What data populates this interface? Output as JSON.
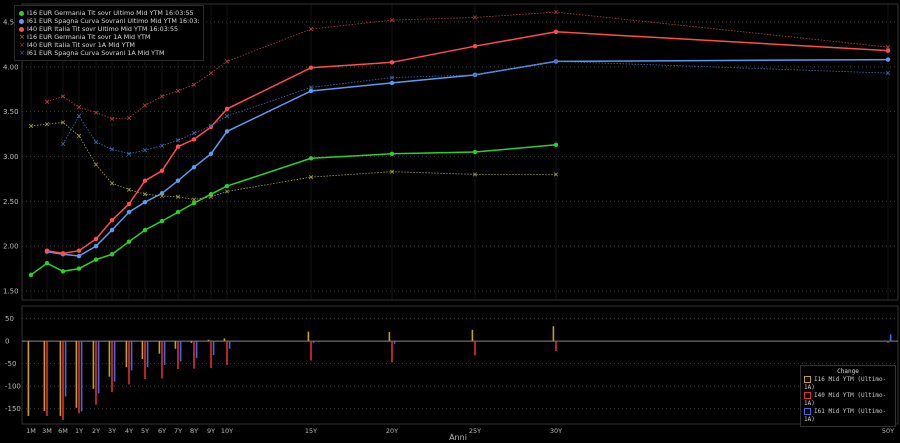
{
  "chart_data": {
    "type": "line",
    "x_categories": [
      "1M",
      "3M",
      "6M",
      "1Y",
      "2Y",
      "3Y",
      "4Y",
      "5Y",
      "6Y",
      "7Y",
      "8Y",
      "9Y",
      "10Y",
      "15Y",
      "20Y",
      "25Y",
      "30Y",
      "50Y"
    ],
    "xlabel": "Anni",
    "ylim": [
      1.4,
      4.7
    ],
    "y_ticks": [
      1.5,
      2.0,
      2.5,
      3.0,
      3.5,
      4.0,
      4.5
    ],
    "y_tick_labels": [
      "1.50",
      "2.00",
      "2.50",
      "3.00",
      "3.50",
      "4.00",
      "4.50"
    ],
    "series": [
      {
        "name": "I16 EUR Germania Tit sovr Ultimo Mid YTM 16:03:55",
        "color": "#2bd12b",
        "style": "solid",
        "values": [
          1.68,
          1.81,
          1.72,
          1.75,
          1.85,
          1.91,
          2.05,
          2.18,
          2.28,
          2.38,
          2.48,
          2.58,
          2.67,
          2.98,
          3.03,
          3.05,
          3.13,
          null
        ]
      },
      {
        "name": "I61 EUR Spagna Curva Sovrani Ultimo Mid YTM 16:03:55",
        "color": "#5c9bf0",
        "style": "solid",
        "values": [
          null,
          1.94,
          1.91,
          1.89,
          2.0,
          2.18,
          2.38,
          2.49,
          2.59,
          2.73,
          2.88,
          3.03,
          3.28,
          3.73,
          3.82,
          3.91,
          4.06,
          4.08
        ]
      },
      {
        "name": "I40 EUR Italia Tit sovr Ultimo Mid YTM 16:03:55",
        "color": "#ff4d4d",
        "style": "solid",
        "values": [
          null,
          1.95,
          1.92,
          1.95,
          2.08,
          2.29,
          2.47,
          2.73,
          2.84,
          3.11,
          3.19,
          3.33,
          3.53,
          3.99,
          4.05,
          4.23,
          4.39,
          4.18
        ]
      },
      {
        "name": "I16 EUR Germania Tit sovr 1A Mid YTM",
        "color": "#a8a032",
        "style": "dotted",
        "values": [
          3.34,
          3.36,
          3.38,
          3.23,
          2.91,
          2.7,
          2.63,
          2.58,
          2.56,
          2.55,
          2.52,
          2.55,
          2.61,
          2.77,
          2.83,
          2.8,
          2.8,
          null
        ]
      },
      {
        "name": "I40 EUR Italia Tit sovr 1A Mid YTM",
        "color": "#b84040",
        "style": "dotted",
        "values": [
          null,
          3.61,
          3.67,
          3.55,
          3.49,
          3.42,
          3.43,
          3.57,
          3.67,
          3.73,
          3.8,
          3.93,
          4.06,
          4.42,
          4.52,
          4.55,
          4.61,
          4.22
        ]
      },
      {
        "name": "I61 EUR Spagna Curva Sovrani 1A Mid YTM",
        "color": "#3e6cb8",
        "style": "dotted",
        "values": [
          null,
          null,
          3.14,
          3.45,
          3.16,
          3.08,
          3.03,
          3.07,
          3.12,
          3.18,
          3.26,
          3.34,
          3.45,
          3.77,
          3.88,
          3.91,
          4.06,
          3.93
        ]
      }
    ],
    "lower_panel": {
      "title": "Change",
      "ylim": [
        -175,
        60
      ],
      "y_ticks": [
        50,
        0,
        -50,
        -100,
        -150
      ],
      "y_tick_labels": [
        "50",
        "0",
        "-50",
        "-100",
        "-150"
      ],
      "series": [
        {
          "name": "I16 Mid YTM (Ultimo-1A)",
          "color": "#c8a020",
          "values": [
            -166,
            -155,
            -166,
            -148,
            -106,
            -79,
            -58,
            -40,
            -28,
            -17,
            -4,
            3,
            6,
            21,
            20,
            25,
            33,
            null
          ]
        },
        {
          "name": "I40 Mid YTM (Ultimo-1A)",
          "color": "#e03030",
          "values": [
            null,
            -166,
            -175,
            -160,
            -141,
            -113,
            -96,
            -84,
            -83,
            -62,
            -61,
            -60,
            -53,
            -43,
            -47,
            -32,
            -22,
            -4
          ]
        },
        {
          "name": "I61 Mid YTM (Ultimo-1A)",
          "color": "#3e6ce0",
          "values": [
            null,
            null,
            -123,
            -156,
            -116,
            -90,
            -65,
            -58,
            -53,
            -45,
            -38,
            -31,
            -17,
            -4,
            -6,
            0,
            0,
            15
          ]
        }
      ]
    }
  },
  "legend_top": [
    {
      "label": "I16 EUR Germania Tit sovr Ultimo Mid YTM 16:03:55",
      "color": "#2bd12b",
      "marker": "dot"
    },
    {
      "label": "I61 EUR Spagna Curva Sovrani Ultimo Mid YTM 16:03:55",
      "color": "#5c9bf0",
      "marker": "dot"
    },
    {
      "label": "I40 EUR Italia Tit sovr Ultimo Mid YTM 16:03:55",
      "color": "#ff4d4d",
      "marker": "dot"
    },
    {
      "label": "I16 EUR Germania Tit sovr 1A Mid YTM",
      "color": "#a8a032",
      "marker": "x"
    },
    {
      "label": "I40 EUR Italia Tit sovr 1A Mid YTM",
      "color": "#b84040",
      "marker": "x"
    },
    {
      "label": "I61 EUR Spagna Curva Sovrani 1A Mid YTM",
      "color": "#3e6cb8",
      "marker": "x"
    }
  ],
  "legend_bottom": {
    "title": "Change",
    "items": [
      {
        "label": "I16 Mid YTM (Ultimo-1A)",
        "color": "#c8a020"
      },
      {
        "label": "I40 Mid YTM (Ultimo-1A)",
        "color": "#e03030"
      },
      {
        "label": "I61 Mid YTM (Ultimo-1A)",
        "color": "#3e6ce0"
      }
    ]
  }
}
